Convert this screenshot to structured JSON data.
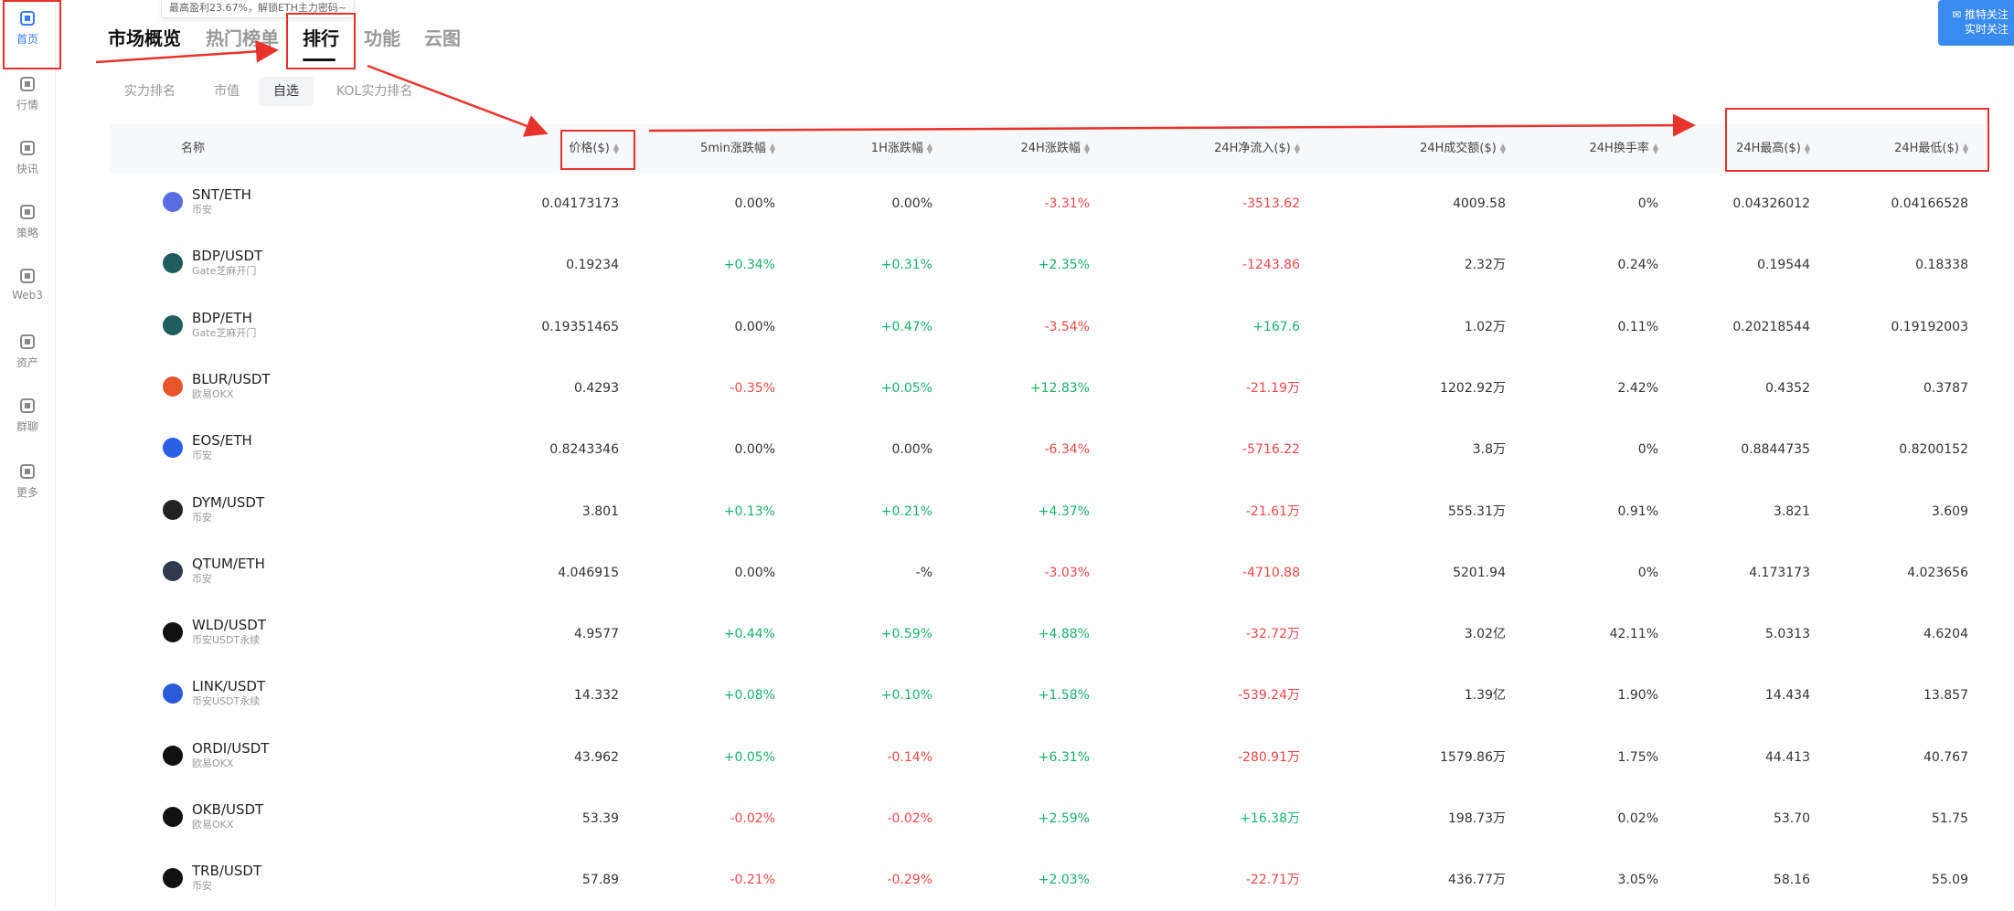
{
  "tooltip": "最高盈利23.67%，解锁ETH主力密码~",
  "sidebar": {
    "items": [
      {
        "label": "首页",
        "icon": "home-globe-icon"
      },
      {
        "label": "行情",
        "icon": "bar-chart-icon"
      },
      {
        "label": "快讯",
        "icon": "news-icon"
      },
      {
        "label": "策略",
        "icon": "robot-icon"
      },
      {
        "label": "Web3",
        "icon": "web3-icon"
      },
      {
        "label": "资产",
        "icon": "wallet-icon"
      },
      {
        "label": "群聊",
        "icon": "chat-icon"
      },
      {
        "label": "更多",
        "icon": "grid-more-icon"
      }
    ]
  },
  "main_tabs": [
    "市场概览",
    "热门榜单",
    "排行",
    "功能",
    "云图"
  ],
  "sub_tabs": [
    "实力排名",
    "市值",
    "自选",
    "KOL实力排名"
  ],
  "follow_button": {
    "line1": "推特关注",
    "line2": "实时关注"
  },
  "columns": [
    "名称",
    "价格($)",
    "5min涨跌幅",
    "1H涨跌幅",
    "24H涨跌幅",
    "24H净流入($)",
    "24H成交额($)",
    "24H换手率",
    "24H最高($)",
    "24H最低($)"
  ],
  "colors": {
    "up": "#19b36b",
    "down": "#f04848",
    "accent": "#3a7bf5",
    "annotation": "#e8332c"
  },
  "rows": [
    {
      "pair": "SNT/ETH",
      "exchange": "币安",
      "price": "0.04173173",
      "m5": "0.00%",
      "h1": "0.00%",
      "h24": "-3.31%",
      "inflow": "-3513.62",
      "volume": "4009.58",
      "turnover": "0%",
      "high": "0.04326012",
      "low": "0.04166528",
      "coin_color": "#5b6ee1"
    },
    {
      "pair": "BDP/USDT",
      "exchange": "Gate芝麻开门",
      "price": "0.19234",
      "m5": "+0.34%",
      "h1": "+0.31%",
      "h24": "+2.35%",
      "inflow": "-1243.86",
      "volume": "2.32万",
      "turnover": "0.24%",
      "high": "0.19544",
      "low": "0.18338",
      "coin_color": "#1f5c5c"
    },
    {
      "pair": "BDP/ETH",
      "exchange": "Gate芝麻开门",
      "price": "0.19351465",
      "m5": "0.00%",
      "h1": "+0.47%",
      "h24": "-3.54%",
      "inflow": "+167.6",
      "volume": "1.02万",
      "turnover": "0.11%",
      "high": "0.20218544",
      "low": "0.19192003",
      "coin_color": "#1f5c5c"
    },
    {
      "pair": "BLUR/USDT",
      "exchange": "欧易OKX",
      "price": "0.4293",
      "m5": "-0.35%",
      "h1": "+0.05%",
      "h24": "+12.83%",
      "inflow": "-21.19万",
      "volume": "1202.92万",
      "turnover": "2.42%",
      "high": "0.4352",
      "low": "0.3787",
      "coin_color": "#e8562a"
    },
    {
      "pair": "EOS/ETH",
      "exchange": "币安",
      "price": "0.8243346",
      "m5": "0.00%",
      "h1": "0.00%",
      "h24": "-6.34%",
      "inflow": "-5716.22",
      "volume": "3.8万",
      "turnover": "0%",
      "high": "0.8844735",
      "low": "0.8200152",
      "coin_color": "#2c5fe8"
    },
    {
      "pair": "DYM/USDT",
      "exchange": "币安",
      "price": "3.801",
      "m5": "+0.13%",
      "h1": "+0.21%",
      "h24": "+4.37%",
      "inflow": "-21.61万",
      "volume": "555.31万",
      "turnover": "0.91%",
      "high": "3.821",
      "low": "3.609",
      "coin_color": "#222222"
    },
    {
      "pair": "QTUM/ETH",
      "exchange": "币安",
      "price": "4.046915",
      "m5": "0.00%",
      "h1": "-%",
      "h24": "-3.03%",
      "inflow": "-4710.88",
      "volume": "5201.94",
      "turnover": "0%",
      "high": "4.173173",
      "low": "4.023656",
      "coin_color": "#2e3a4e"
    },
    {
      "pair": "WLD/USDT",
      "exchange": "币安USDT永续",
      "price": "4.9577",
      "m5": "+0.44%",
      "h1": "+0.59%",
      "h24": "+4.88%",
      "inflow": "-32.72万",
      "volume": "3.02亿",
      "turnover": "42.11%",
      "high": "5.0313",
      "low": "4.6204",
      "coin_color": "#111111"
    },
    {
      "pair": "LINK/USDT",
      "exchange": "币安USDT永续",
      "price": "14.332",
      "m5": "+0.08%",
      "h1": "+0.10%",
      "h24": "+1.58%",
      "inflow": "-539.24万",
      "volume": "1.39亿",
      "turnover": "1.90%",
      "high": "14.434",
      "low": "13.857",
      "coin_color": "#2a5ada"
    },
    {
      "pair": "ORDI/USDT",
      "exchange": "欧易OKX",
      "price": "43.962",
      "m5": "+0.05%",
      "h1": "-0.14%",
      "h24": "+6.31%",
      "inflow": "-280.91万",
      "volume": "1579.86万",
      "turnover": "1.75%",
      "high": "44.413",
      "low": "40.767",
      "coin_color": "#111111"
    },
    {
      "pair": "OKB/USDT",
      "exchange": "欧易OKX",
      "price": "53.39",
      "m5": "-0.02%",
      "h1": "-0.02%",
      "h24": "+2.59%",
      "inflow": "+16.38万",
      "volume": "198.73万",
      "turnover": "0.02%",
      "high": "53.70",
      "low": "51.75",
      "coin_color": "#111111"
    },
    {
      "pair": "TRB/USDT",
      "exchange": "币安",
      "price": "57.89",
      "m5": "-0.21%",
      "h1": "-0.29%",
      "h24": "+2.03%",
      "inflow": "-22.71万",
      "volume": "436.77万",
      "turnover": "3.05%",
      "high": "58.16",
      "low": "55.09",
      "coin_color": "#111111"
    }
  ]
}
